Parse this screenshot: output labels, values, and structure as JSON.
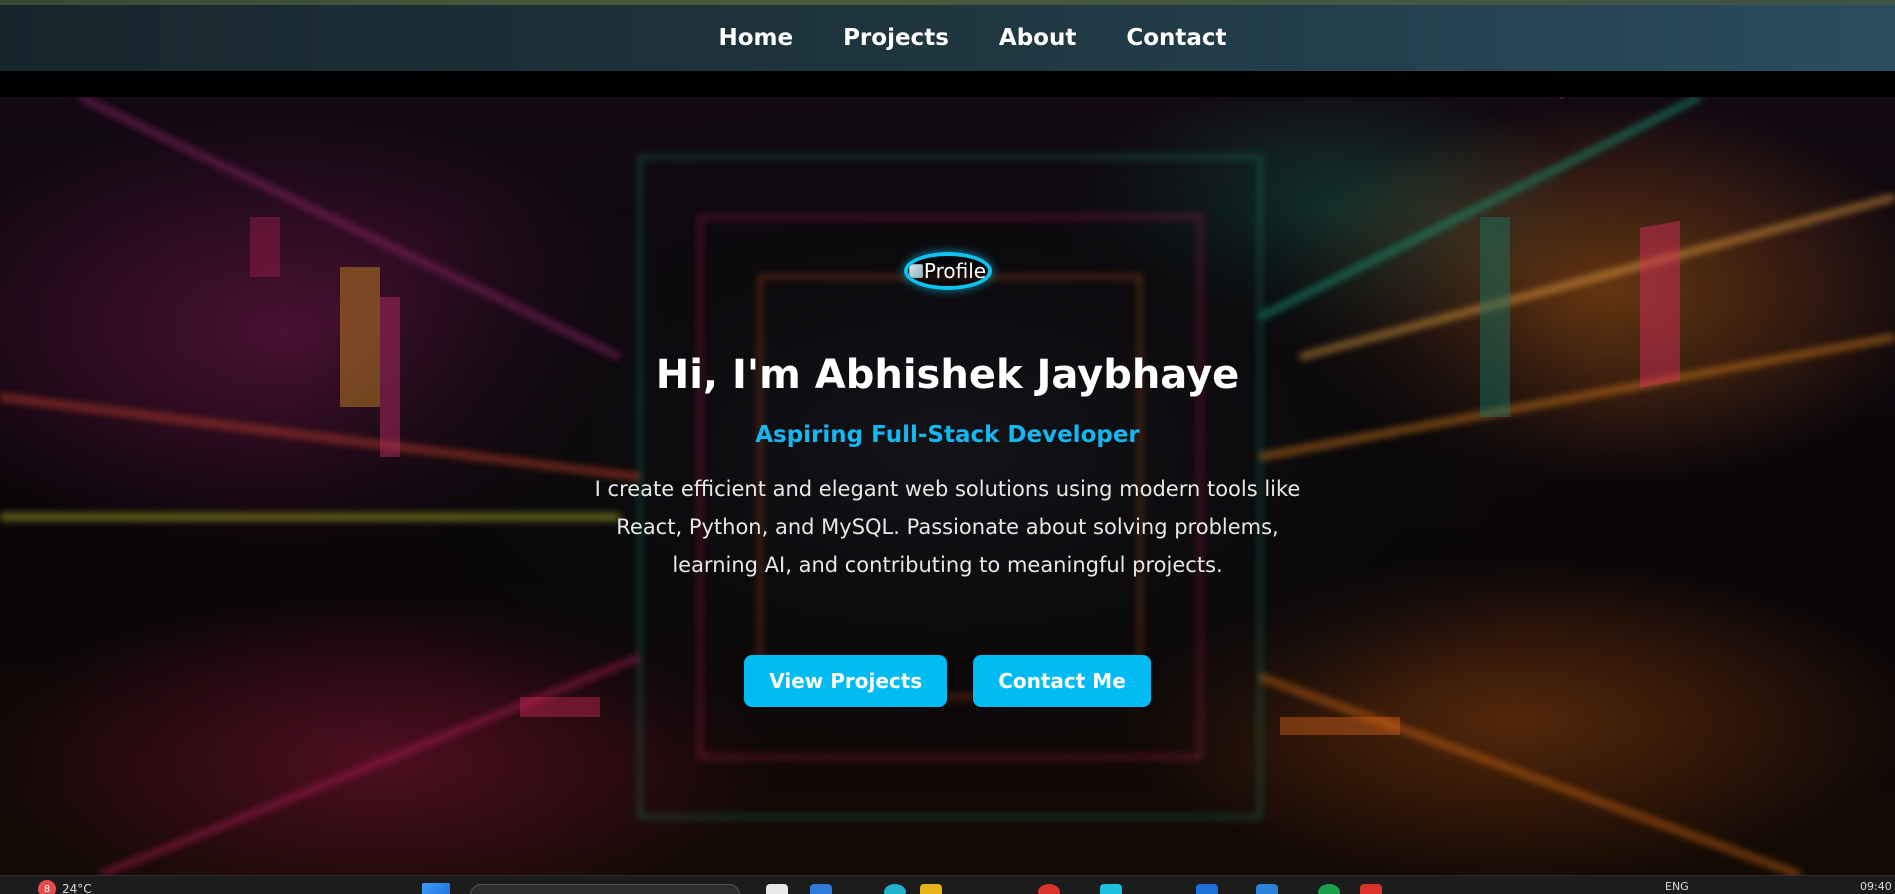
{
  "nav": {
    "items": [
      {
        "label": "Home"
      },
      {
        "label": "Projects"
      },
      {
        "label": "About"
      },
      {
        "label": "Contact"
      }
    ]
  },
  "hero": {
    "profile_alt": "Profile",
    "title": "Hi, I'm Abhishek Jaybhaye",
    "subtitle": "Aspiring Full-Stack Developer",
    "description": "I create efficient and elegant web solutions using modern tools like React, Python, and MySQL. Passionate about solving problems, learning AI, and contributing to meaningful projects.",
    "buttons": {
      "view_projects": "View Projects",
      "contact_me": "Contact Me"
    }
  },
  "taskbar": {
    "notification_count": "8",
    "temperature": "24°C",
    "language": "ENG",
    "time": "09:40"
  },
  "colors": {
    "accent": "#00bcf2",
    "subtitle": "#14b7f0",
    "nav_bg_left": "#17262d",
    "nav_bg_right": "#2a4d5e"
  },
  "icons": [
    "broken-image-icon",
    "windows-start-icon",
    "search-icon",
    "app-icon"
  ]
}
